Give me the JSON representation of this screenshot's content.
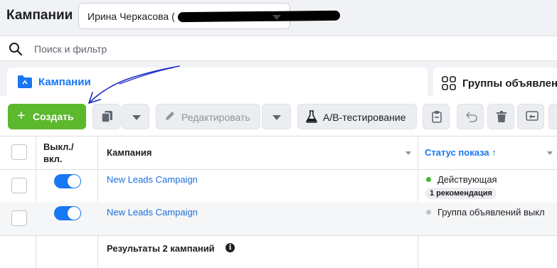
{
  "header": {
    "title": "Кампании",
    "account": {
      "name": "Ирина Черкасова ("
    }
  },
  "search": {
    "placeholder": "Поиск и фильтр"
  },
  "tabs": [
    {
      "label": "Кампании",
      "active": true
    },
    {
      "label": "Группы объявлений",
      "active": false
    }
  ],
  "toolbar": {
    "create_label": "Создать",
    "edit_label": "Редактировать",
    "ab_label": "A/B-тестирование"
  },
  "table": {
    "columns": {
      "toggle": "Выкл./\nвкл.",
      "campaign": "Кампания",
      "status": "Статус показа ↑"
    },
    "rows": [
      {
        "name": "New Leads Campaign",
        "on": true,
        "status": "Действующая",
        "status_color": "#42b72a",
        "badge": "1 рекомендация"
      },
      {
        "name": "New Leads Campaign",
        "on": true,
        "status": "Группа объявлений выкл",
        "status_color": "#bec3c9"
      }
    ],
    "results_label": "Результаты 2 кампаний"
  },
  "colors": {
    "accent": "#1877f2",
    "create": "#5cb82d"
  }
}
